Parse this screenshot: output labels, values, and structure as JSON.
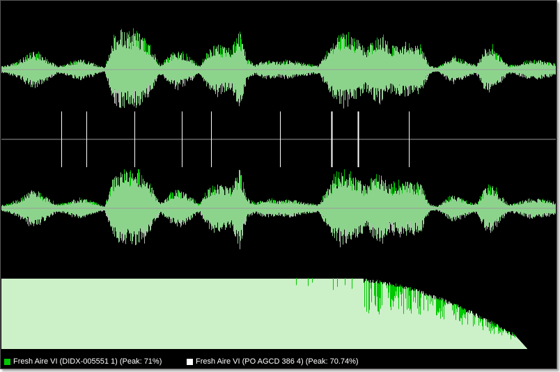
{
  "colors": {
    "background": "#000000",
    "series_a": "#00c800",
    "series_a_fill": "#8cd48c",
    "series_b": "#ffffff",
    "spectrum_fill": "#ccf0c8",
    "marker_line": "#ffffff",
    "center_line": "#9a9a9a"
  },
  "legend": {
    "items": [
      {
        "label": "Fresh Aire VI (DIDX-005551 1) (Peak: 71%)",
        "color": "#00c800",
        "peak_percent": 71
      },
      {
        "label": "Fresh Aire VI (PO AGCD 386 4) (Peak: 70.74%)",
        "color": "#ffffff",
        "peak_percent": 70.74
      }
    ]
  },
  "markers": {
    "count": 9,
    "positions_fraction": [
      0.108,
      0.153,
      0.24,
      0.325,
      0.378,
      0.503,
      0.595,
      0.643,
      0.735
    ]
  },
  "waveform": {
    "envelope": [
      0.08,
      0.12,
      0.2,
      0.32,
      0.45,
      0.36,
      0.22,
      0.1,
      0.12,
      0.2,
      0.25,
      0.2,
      0.12,
      0.05,
      0.7,
      0.95,
      0.85,
      0.9,
      0.75,
      0.5,
      0.12,
      0.3,
      0.45,
      0.38,
      0.25,
      0.1,
      0.45,
      0.6,
      0.55,
      0.5,
      0.95,
      0.25,
      0.12,
      0.2,
      0.22,
      0.18,
      0.22,
      0.2,
      0.15,
      0.12,
      0.1,
      0.4,
      0.75,
      0.85,
      0.8,
      0.7,
      0.5,
      0.75,
      0.8,
      0.55,
      0.6,
      0.65,
      0.6,
      0.55,
      0.1,
      0.05,
      0.2,
      0.32,
      0.25,
      0.15,
      0.12,
      0.5,
      0.55,
      0.3,
      0.1,
      0.12,
      0.2,
      0.25,
      0.22,
      0.18,
      0.15
    ]
  }
}
